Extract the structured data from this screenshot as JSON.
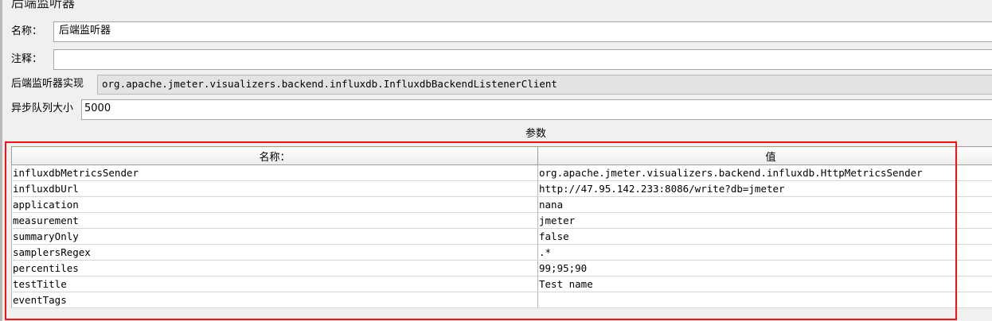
{
  "panel": {
    "title": "后端监听器",
    "name_label": "名称：",
    "name_value": "后端监听器",
    "comment_label": "注释：",
    "comment_value": "",
    "impl_label": "后端监听器实现",
    "impl_value": "org.apache.jmeter.visualizers.backend.influxdb.InfluxdbBackendListenerClient",
    "queue_label": "异步队列大小",
    "queue_value": "5000"
  },
  "params": {
    "title": "参数",
    "columns": [
      "名称：",
      "值"
    ],
    "rows": [
      [
        "influxdbMetricsSender",
        "org.apache.jmeter.visualizers.backend.influxdb.HttpMetricsSender"
      ],
      [
        "influxdbUrl",
        "http://47.95.142.233:8086/write?db=jmeter"
      ],
      [
        "application",
        "nana"
      ],
      [
        "measurement",
        "jmeter"
      ],
      [
        "summaryOnly",
        "false"
      ],
      [
        "samplersRegex",
        ".*"
      ],
      [
        "percentiles",
        "99;95;90"
      ],
      [
        "testTitle",
        "Test name"
      ],
      [
        "eventTags",
        ""
      ]
    ],
    "highlight_color": "#ff1010"
  }
}
